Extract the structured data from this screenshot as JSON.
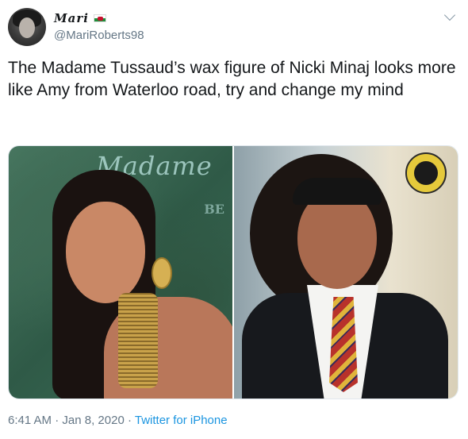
{
  "user": {
    "display_name": "Mari",
    "handle": "@MariRoberts98"
  },
  "tweet": {
    "text": "The Madame Tussaud’s wax figure of Nicki Minaj looks more like Amy from Waterloo road, try and change my mind"
  },
  "media": {
    "left_sign_text": "Madame",
    "left_sign_sub": "BE"
  },
  "footer": {
    "time": "6:41 AM",
    "separator_1": " · ",
    "date": "Jan 8, 2020",
    "separator_2": " · ",
    "source": "Twitter for iPhone"
  },
  "icons": {
    "flag": "wales-flag-icon",
    "menu": "chevron-down-icon"
  },
  "colors": {
    "text": "#14171a",
    "secondary": "#657786",
    "link": "#1b95e0"
  }
}
